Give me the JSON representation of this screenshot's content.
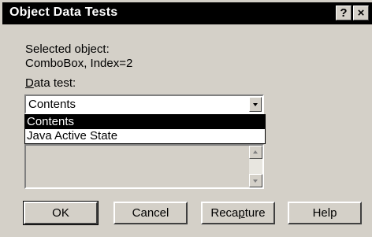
{
  "window": {
    "title": "Object Data Tests",
    "help_glyph": "?",
    "close_glyph": "×"
  },
  "info": {
    "selected_label": "Selected object:",
    "selected_value": "ComboBox, Index=2"
  },
  "data_test": {
    "label_prefix": "D",
    "label_rest": "ata test:",
    "selected": "Contents",
    "options": [
      "Contents",
      "Java Active State"
    ]
  },
  "buttons": {
    "ok": "OK",
    "cancel": "Cancel",
    "recapture_a": "Reca",
    "recapture_u": "p",
    "recapture_b": "ture",
    "help": "Help"
  },
  "colors": {
    "face": "#d4d0c8",
    "titlebar": "#000000",
    "selection": "#000000"
  }
}
